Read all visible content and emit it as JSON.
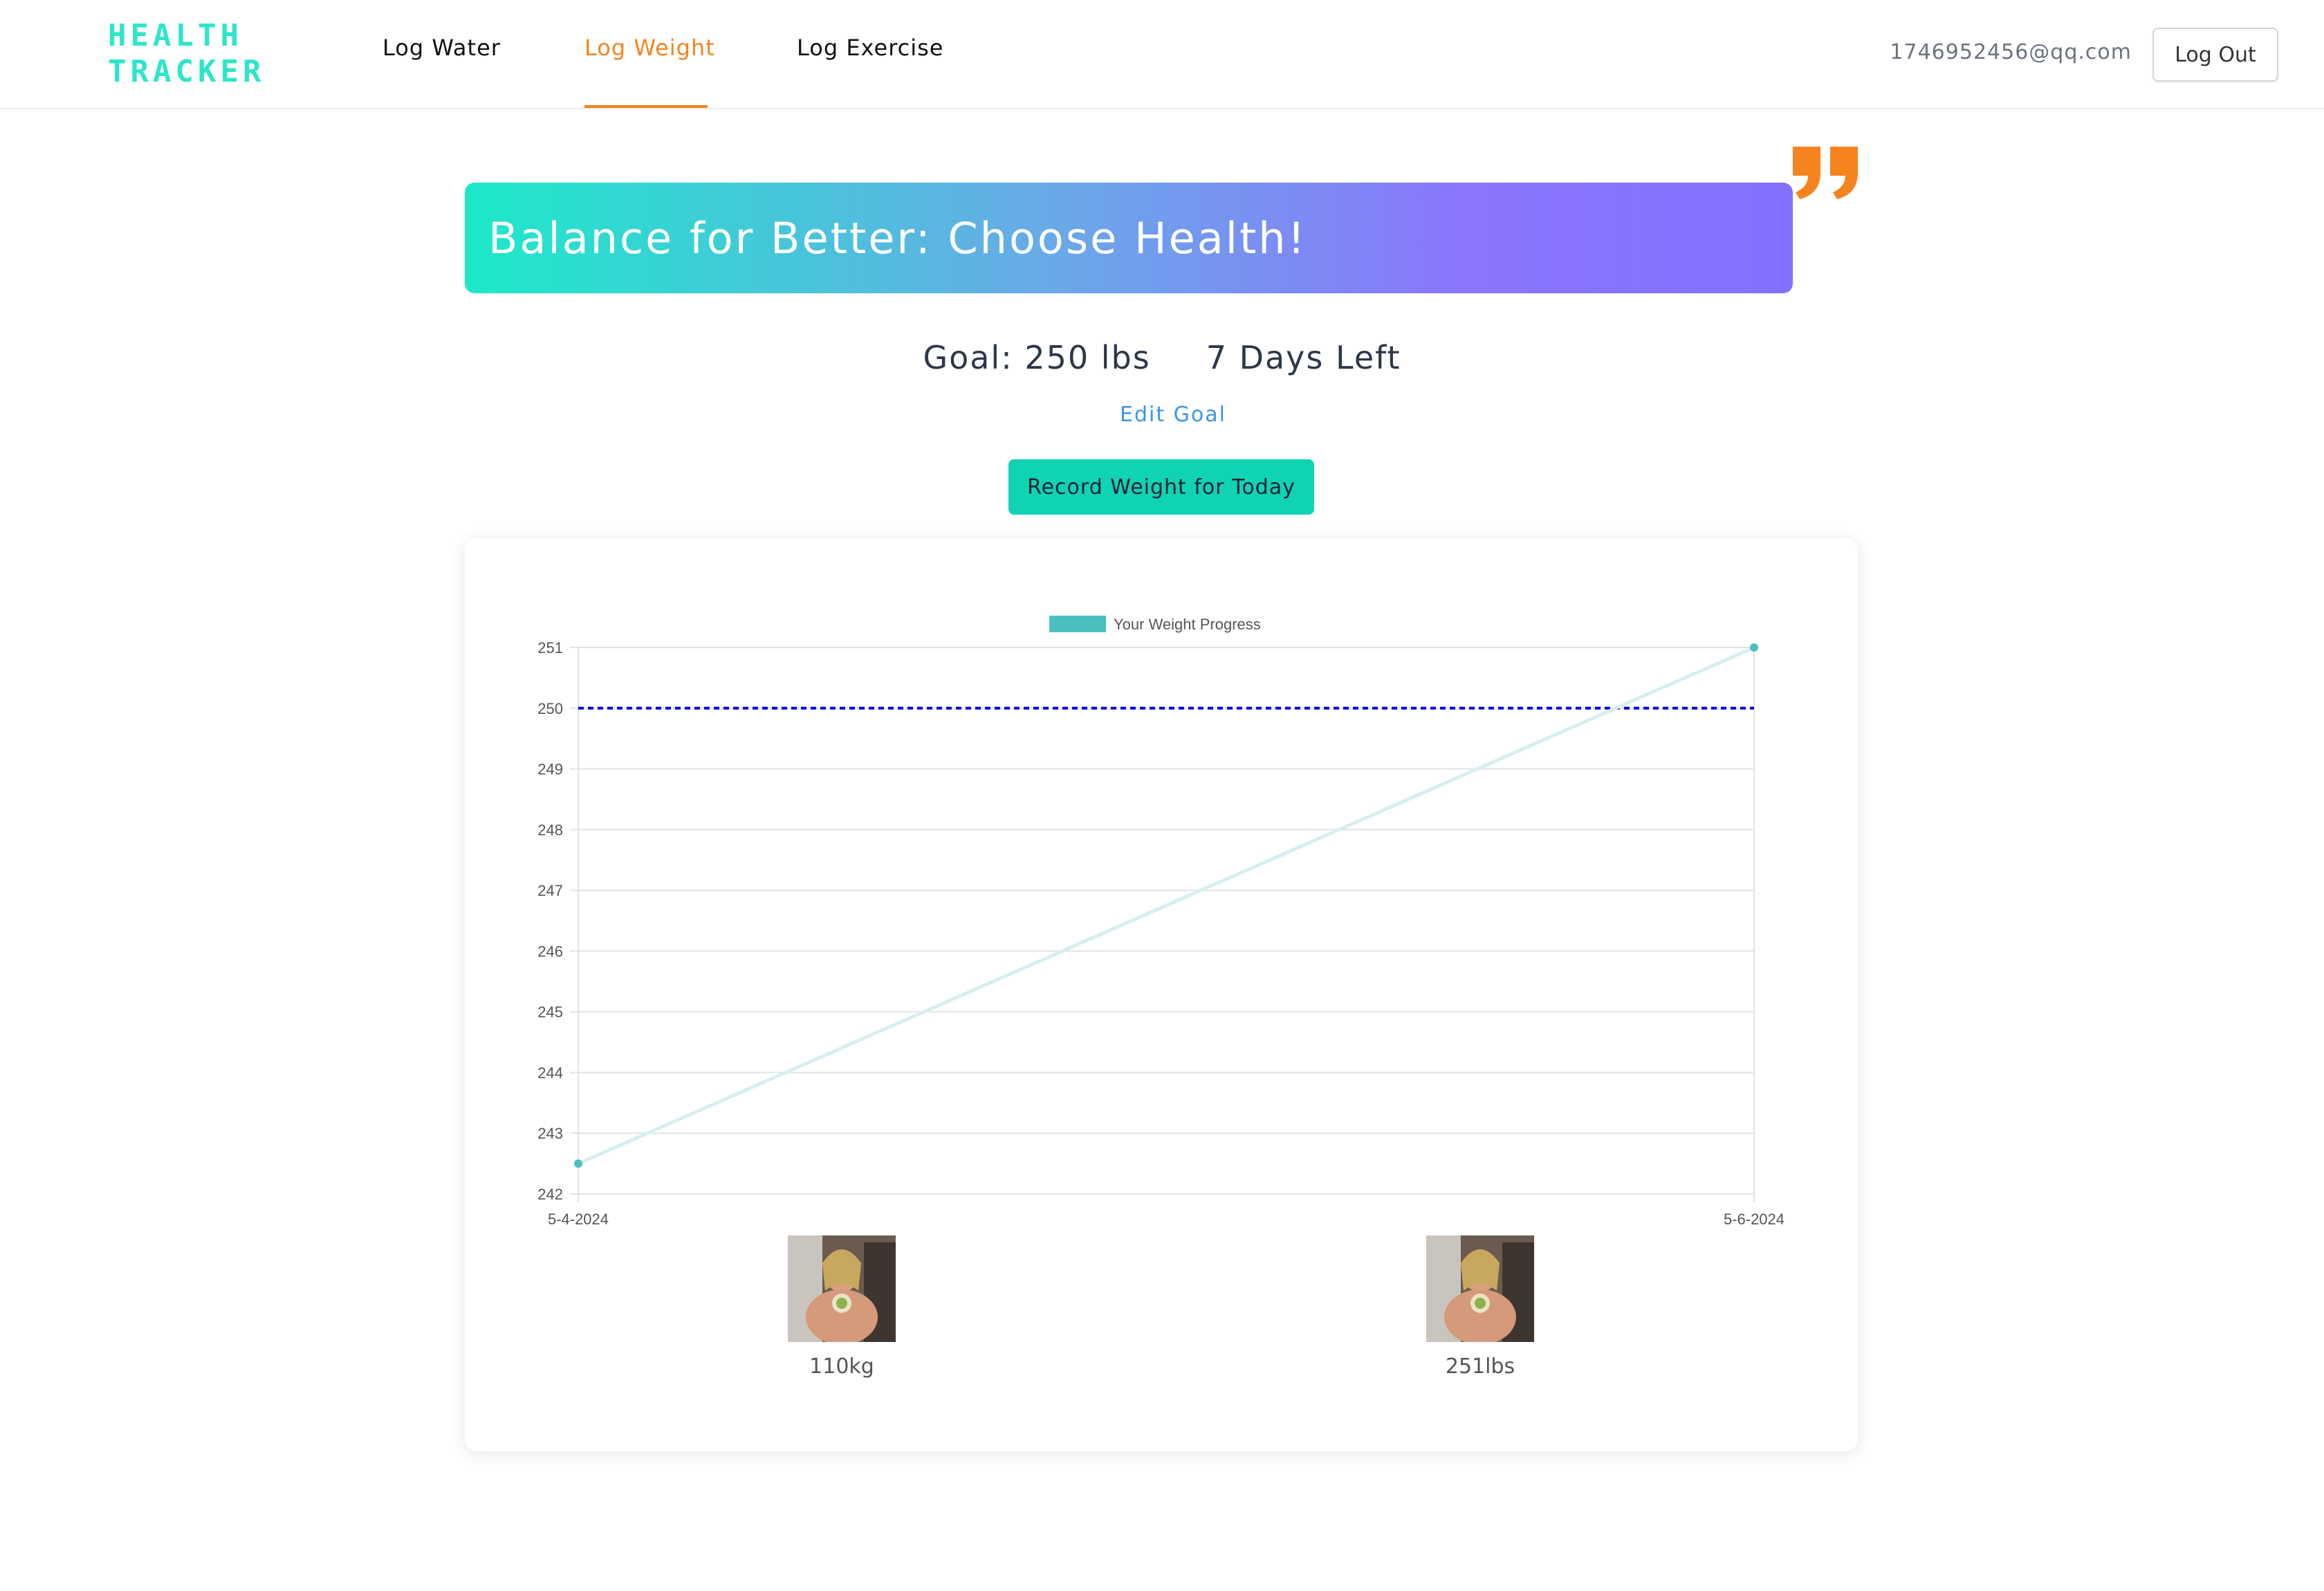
{
  "app": {
    "logo_line1": "HEALTH",
    "logo_line2": "TRACKER"
  },
  "nav": {
    "items": [
      {
        "label": "Log Water"
      },
      {
        "label": "Log Weight",
        "active": true
      },
      {
        "label": "Log Exercise"
      }
    ],
    "user_email": "1746952456@qq.com",
    "logout_label": "Log Out"
  },
  "banner": {
    "text": "Balance for Better: Choose Health!"
  },
  "goal": {
    "goal_text": "Goal: 250 lbs",
    "days_left_text": "7 Days Left",
    "edit_label": "Edit Goal",
    "record_label": "Record Weight for Today"
  },
  "colors": {
    "accent": "#f5841f",
    "teal": "#0fd3b4",
    "line": "#4bc0c0",
    "goal_line": "#0000e6"
  },
  "chart_data": {
    "type": "line",
    "legend": "Your Weight Progress",
    "x": [
      "5-4-2024",
      "5-6-2024"
    ],
    "series": [
      {
        "name": "Your Weight Progress",
        "values": [
          242.5,
          251
        ]
      }
    ],
    "goal_line": 250,
    "ylim": [
      242,
      251
    ],
    "yticks": [
      "242",
      "243",
      "244",
      "245",
      "246",
      "247",
      "248",
      "249",
      "250",
      "251"
    ],
    "grid": true
  },
  "photos": [
    {
      "label": "110kg"
    },
    {
      "label": "251lbs"
    }
  ]
}
